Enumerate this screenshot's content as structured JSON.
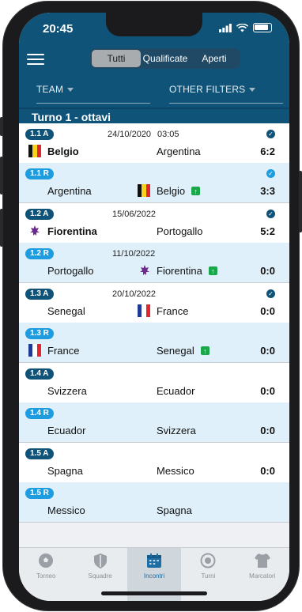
{
  "status": {
    "time": "20:45"
  },
  "segments": [
    "Tutti",
    "Qualificate",
    "Aperti"
  ],
  "filters": {
    "team": "TEAM",
    "other": "OTHER FILTERS"
  },
  "round_title": "Turno 1 - ottavi",
  "matches": [
    {
      "first": {
        "code": "1.1 A",
        "date": "24/10/2020",
        "time": "03:05",
        "home": "Belgio",
        "away": "Argentina",
        "score": "6:2"
      },
      "ret": {
        "code": "1.1 R",
        "date": "",
        "home": "Argentina",
        "away": "Belgio",
        "score": "3:3"
      }
    },
    {
      "first": {
        "code": "1.2 A",
        "date": "15/06/2022",
        "home": "Fiorentina",
        "away": "Portogallo",
        "score": "5:2"
      },
      "ret": {
        "code": "1.2 R",
        "date": "11/10/2022",
        "home": "Portogallo",
        "away": "Fiorentina",
        "score": "0:0"
      }
    },
    {
      "first": {
        "code": "1.3 A",
        "date": "20/10/2022",
        "home": "Senegal",
        "away": "France",
        "score": "0:0"
      },
      "ret": {
        "code": "1.3 R",
        "home": "France",
        "away": "Senegal",
        "score": "0:0"
      }
    },
    {
      "first": {
        "code": "1.4 A",
        "home": "Svizzera",
        "away": "Ecuador",
        "score": "0:0"
      },
      "ret": {
        "code": "1.4 R",
        "home": "Ecuador",
        "away": "Svizzera",
        "score": "0:0"
      }
    },
    {
      "first": {
        "code": "1.5 A",
        "home": "Spagna",
        "away": "Messico",
        "score": "0:0"
      },
      "ret": {
        "code": "1.5 R",
        "home": "Messico",
        "away": "Spagna"
      }
    }
  ],
  "tabs": [
    "Torneo",
    "Squadre",
    "Incontri",
    "Turni",
    "Marcatori"
  ],
  "colors": {
    "header": "#0f5379",
    "accent": "#1d9de0",
    "qualified": "#1aa64a"
  }
}
